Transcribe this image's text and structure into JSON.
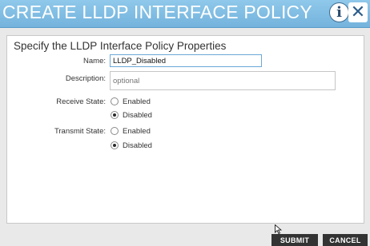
{
  "dialog": {
    "title": "CREATE LLDP INTERFACE POLICY",
    "info_icon": "i",
    "close_icon": "✕"
  },
  "form": {
    "section_title": "Specify the LLDP Interface Policy Properties",
    "name": {
      "label": "Name:",
      "value": "LLDP_Disabled"
    },
    "description": {
      "label": "Description:",
      "placeholder": "optional",
      "value": ""
    },
    "receive_state": {
      "label": "Receive State:",
      "options": [
        "Enabled",
        "Disabled"
      ],
      "selected": "Disabled"
    },
    "transmit_state": {
      "label": "Transmit State:",
      "options": [
        "Enabled",
        "Disabled"
      ],
      "selected": "Disabled"
    }
  },
  "footer": {
    "submit_label": "SUBMIT",
    "cancel_label": "CANCEL"
  },
  "icons": [
    "info-icon",
    "close-icon",
    "mouse-pointer-icon"
  ],
  "colors": {
    "header": "#7fbde4",
    "button": "#333333",
    "input_focus_border": "#6ba8d6"
  }
}
